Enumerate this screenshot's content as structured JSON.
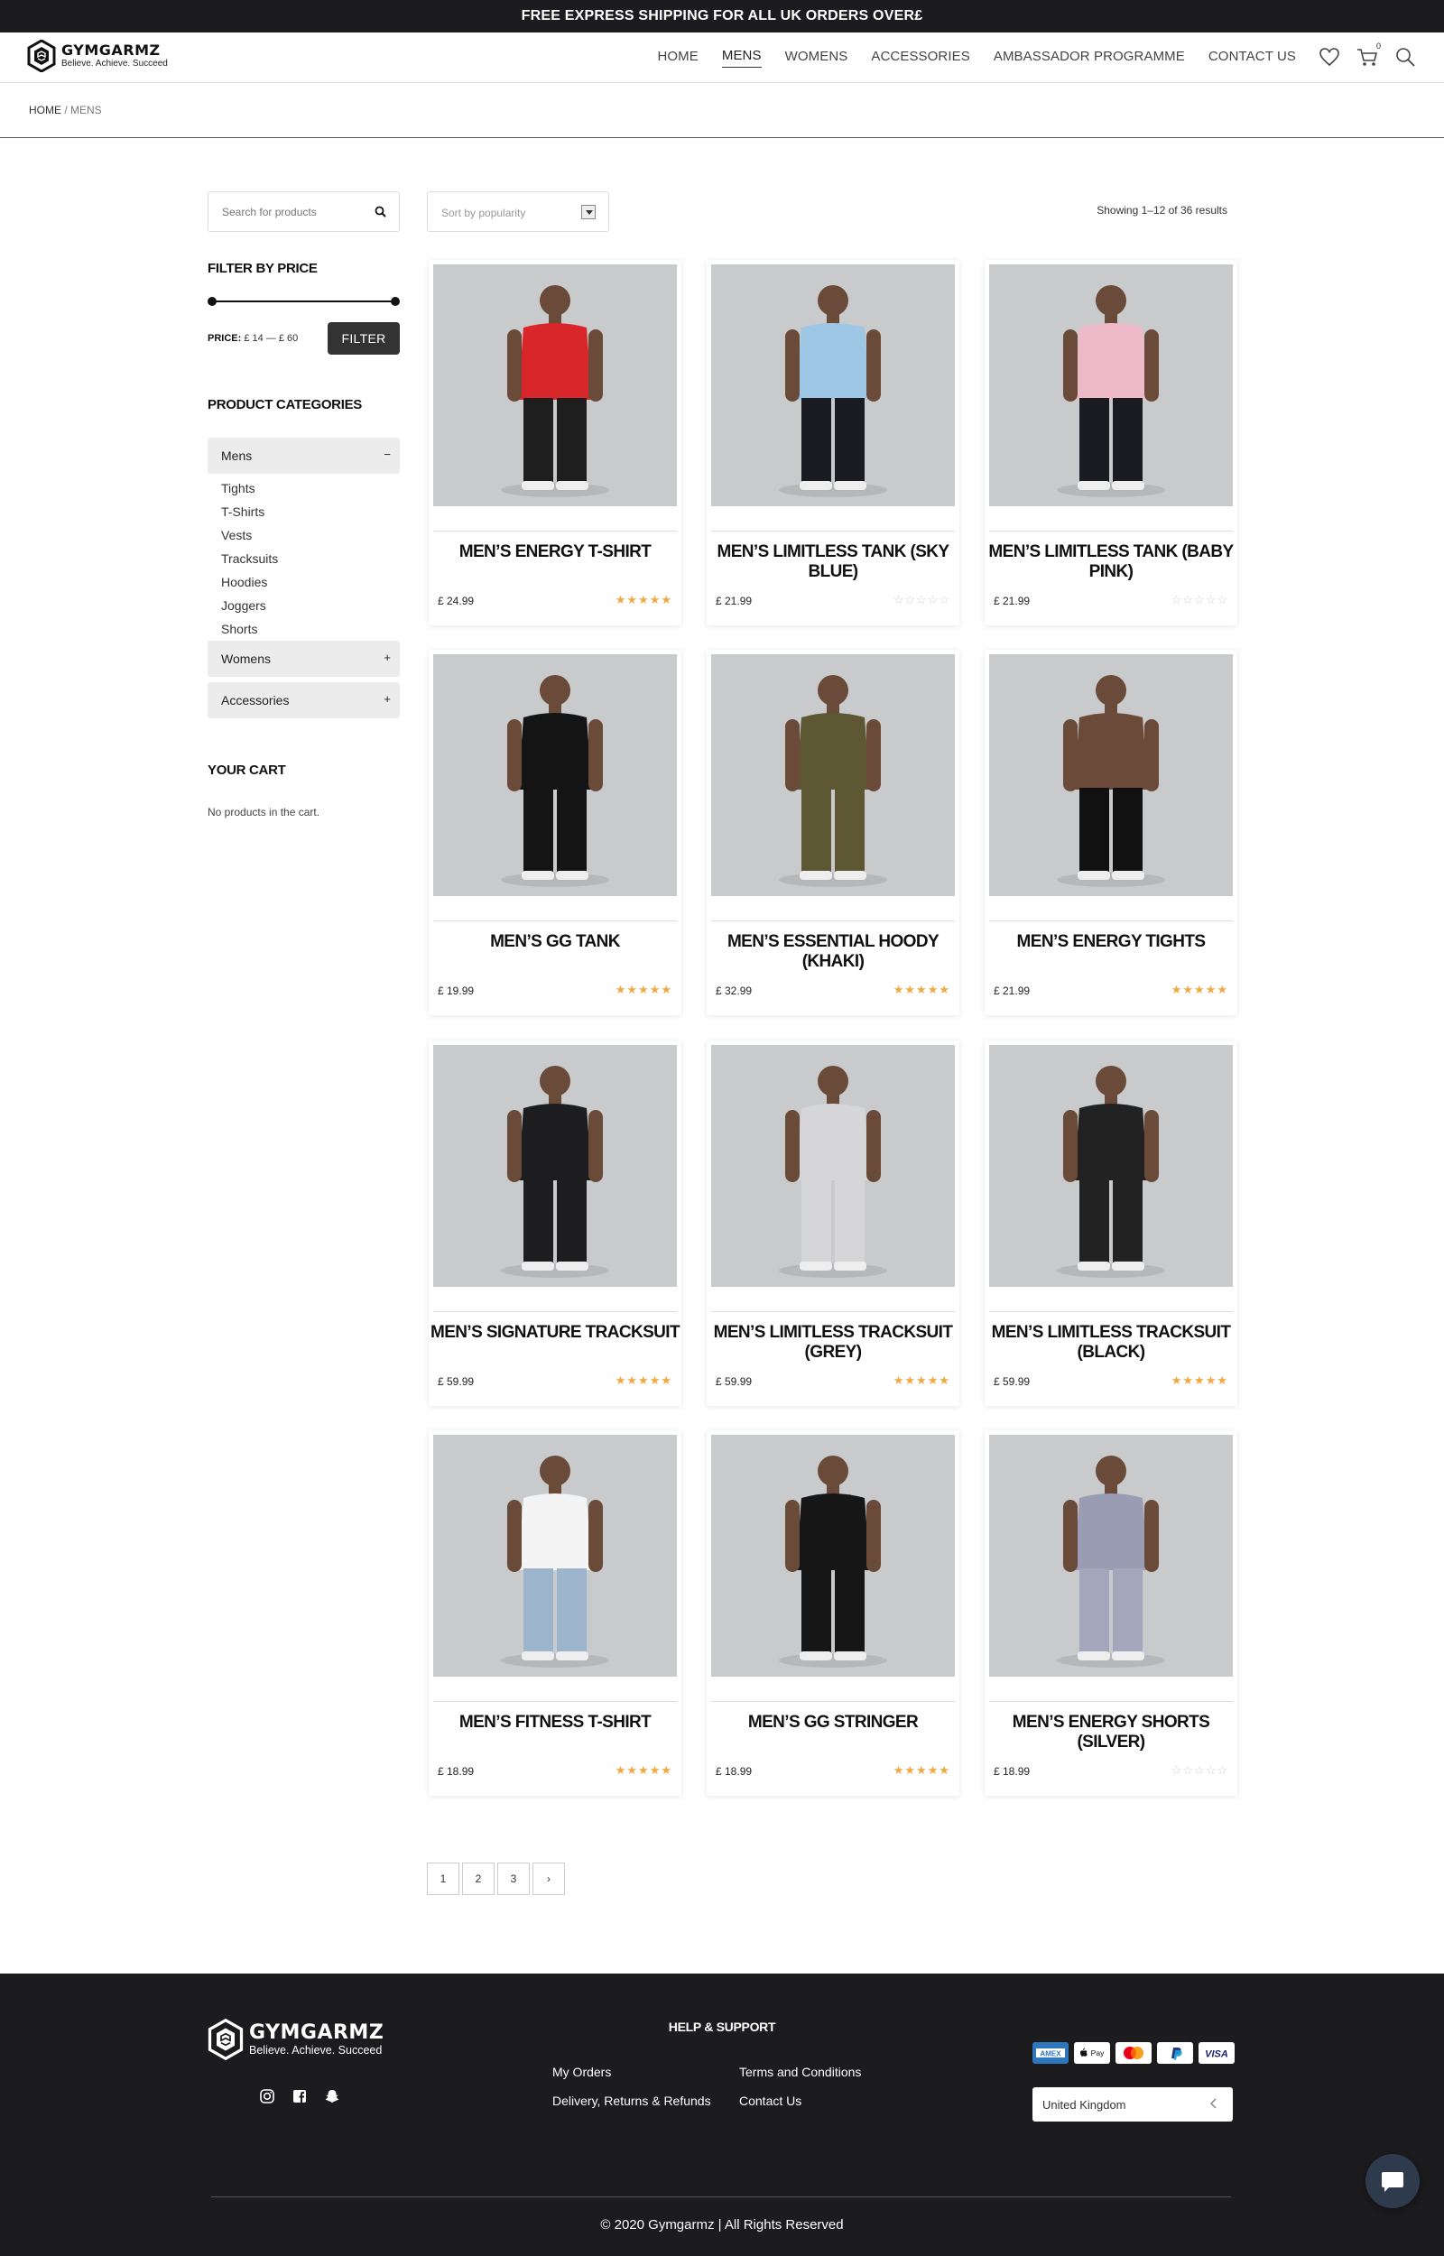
{
  "announcement": "FREE EXPRESS SHIPPING FOR ALL UK ORDERS OVER£",
  "brand": {
    "name": "GYMGARMZ",
    "tagline": "Believe. Achieve. Succeed"
  },
  "nav": [
    "HOME",
    "MENS",
    "WOMENS",
    "ACCESSORIES",
    "AMBASSADOR PROGRAMME",
    "CONTACT US"
  ],
  "nav_active": "MENS",
  "header_icons": [
    "heart-icon",
    "cart-icon",
    "search-icon"
  ],
  "cart_count": "0",
  "breadcrumb": {
    "home": "HOME",
    "sep": " / ",
    "current": "MENS"
  },
  "sidebar": {
    "search_placeholder": "Search for products",
    "filter_title": "FILTER BY PRICE",
    "price_label": "PRICE:",
    "price_range": "£ 14 — £ 60",
    "filter_button": "FILTER",
    "categories_title": "PRODUCT CATEGORIES",
    "categories": [
      {
        "label": "Mens",
        "toggle": "−"
      },
      {
        "label": "Womens",
        "toggle": "+"
      },
      {
        "label": "Accessories",
        "toggle": "+"
      }
    ],
    "mens_subcategories": [
      "Tights",
      "T-Shirts",
      "Vests",
      "Tracksuits",
      "Hoodies",
      "Joggers",
      "Shorts"
    ],
    "cart_title": "YOUR CART",
    "cart_empty": "No products in the cart."
  },
  "sort": {
    "label": "Sort by popularity"
  },
  "result_count": "Showing 1–12 of 36 results",
  "products": [
    {
      "name": "MEN’S ENERGY T-SHIRT",
      "price": "£ 24.99",
      "rating": 5,
      "garment": "#d8262b",
      "bottom": "#1e1e1e"
    },
    {
      "name": "MEN’S LIMITLESS TANK (SKY BLUE)",
      "price": "£ 21.99",
      "rating": 0,
      "garment": "#9ec7e6",
      "bottom": "#1a1c22"
    },
    {
      "name": "MEN’S LIMITLESS TANK (BABY PINK)",
      "price": "£ 21.99",
      "rating": 0,
      "garment": "#eeb9c8",
      "bottom": "#1a1c22"
    },
    {
      "name": "MEN’S GG TANK",
      "price": "£ 19.99",
      "rating": 5,
      "garment": "#141414",
      "bottom": "#141414"
    },
    {
      "name": "MEN’S ESSENTIAL HOODY (KHAKI)",
      "price": "£ 32.99",
      "rating": 5,
      "garment": "#5e5734",
      "bottom": "#5e5734"
    },
    {
      "name": "MEN’S ENERGY TIGHTS",
      "price": "£ 21.99",
      "rating": 5,
      "garment": "#6b4a3a",
      "bottom": "#111111"
    },
    {
      "name": "MEN’S SIGNATURE TRACKSUIT",
      "price": "£ 59.99",
      "rating": 5,
      "garment": "#1d1d20",
      "bottom": "#1d1d20"
    },
    {
      "name": "MEN’S LIMITLESS TRACKSUIT (GREY)",
      "price": "£ 59.99",
      "rating": 5,
      "garment": "#d6d6d8",
      "bottom": "#d6d6d8"
    },
    {
      "name": "MEN’S LIMITLESS TRACKSUIT (BLACK)",
      "price": "£ 59.99",
      "rating": 5,
      "garment": "#222222",
      "bottom": "#222222"
    },
    {
      "name": "MEN’S FITNESS T-SHIRT",
      "price": "£ 18.99",
      "rating": 5,
      "garment": "#f4f4f4",
      "bottom": "#9db5cc"
    },
    {
      "name": "MEN’S GG STRINGER",
      "price": "£ 18.99",
      "rating": 5,
      "garment": "#161616",
      "bottom": "#161616"
    },
    {
      "name": "MEN’S ENERGY SHORTS (SILVER)",
      "price": "£ 18.99",
      "rating": 0,
      "garment": "#9a9cb4",
      "bottom": "#a4a6bb"
    }
  ],
  "pagination": [
    "1",
    "2",
    "3",
    "›"
  ],
  "footer": {
    "brand_name": "GYMGARMZ",
    "brand_tagline": "Believe. Achieve. Succeed",
    "socials": [
      "instagram-icon",
      "facebook-icon",
      "snapchat-icon"
    ],
    "help_title": "HELP & SUPPORT",
    "links": [
      "My Orders",
      "Delivery, Returns & Refunds",
      "Terms and Conditions",
      "Contact Us"
    ],
    "payments": [
      "AMEX",
      "Apple Pay",
      "Mastercard",
      "PayPal",
      "VISA"
    ],
    "country": "United Kingdom",
    "copyright": "© 2020 Gymgarmz | All Rights Reserved"
  },
  "colors": {
    "dark": "#1c1b1d",
    "star": "#f0a841",
    "button": "#333333",
    "category_bg": "#ececec"
  }
}
